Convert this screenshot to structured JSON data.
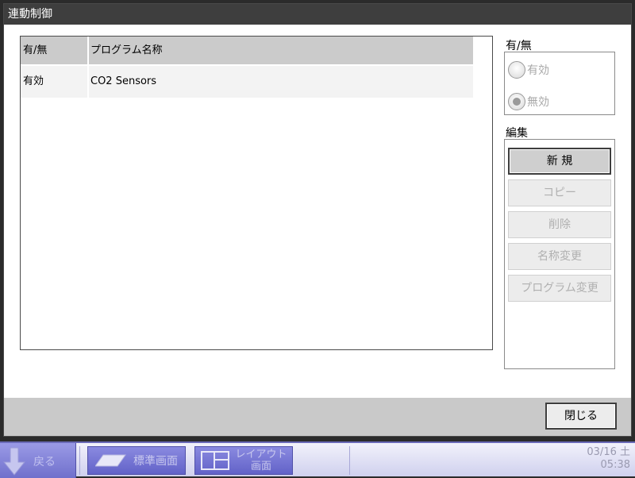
{
  "window": {
    "title": "連動制御"
  },
  "list": {
    "headers": [
      "有/無",
      "プログラム名称"
    ],
    "rows": [
      {
        "enabled": "有効",
        "name": "CO2 Sensors"
      }
    ]
  },
  "enable_section": {
    "label": "有/無",
    "options": [
      "有効",
      "無効"
    ],
    "selected": "無効"
  },
  "edit_section": {
    "label": "編集",
    "buttons": [
      "新 規",
      "コピー",
      "削除",
      "名称変更",
      "プログラム変更"
    ]
  },
  "footer": {
    "close_label": "閉じる"
  },
  "taskbar": {
    "back_label": "戻る",
    "standard_label": "標準画面",
    "layout_label_1": "レイアウト",
    "layout_label_2": "画面",
    "date": "03/16 土",
    "time": "05:38"
  },
  "colors": {
    "title_bar": "#3e3e3e",
    "header_bg": "#cbcbcb",
    "taskbar_accent": "#6a6ab8"
  }
}
